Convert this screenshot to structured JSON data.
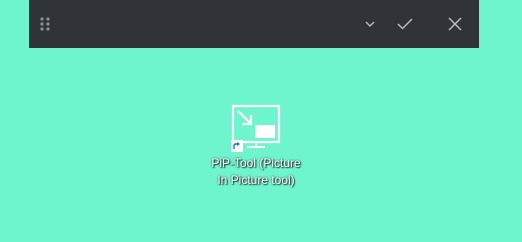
{
  "desktop": {
    "background_color": "#6ff5ce"
  },
  "toolbar": {
    "background_color": "#303338",
    "drag_icon": "grip-dots-icon",
    "dropdown_icon": "chevron-down-icon",
    "confirm_icon": "checkmark-icon",
    "close_icon": "close-icon"
  },
  "shortcut": {
    "icon": "pip-tool-app-icon",
    "overlay_icon": "shortcut-arrow-icon",
    "label": "PiP-Tool (Picture  In Picture tool)"
  }
}
